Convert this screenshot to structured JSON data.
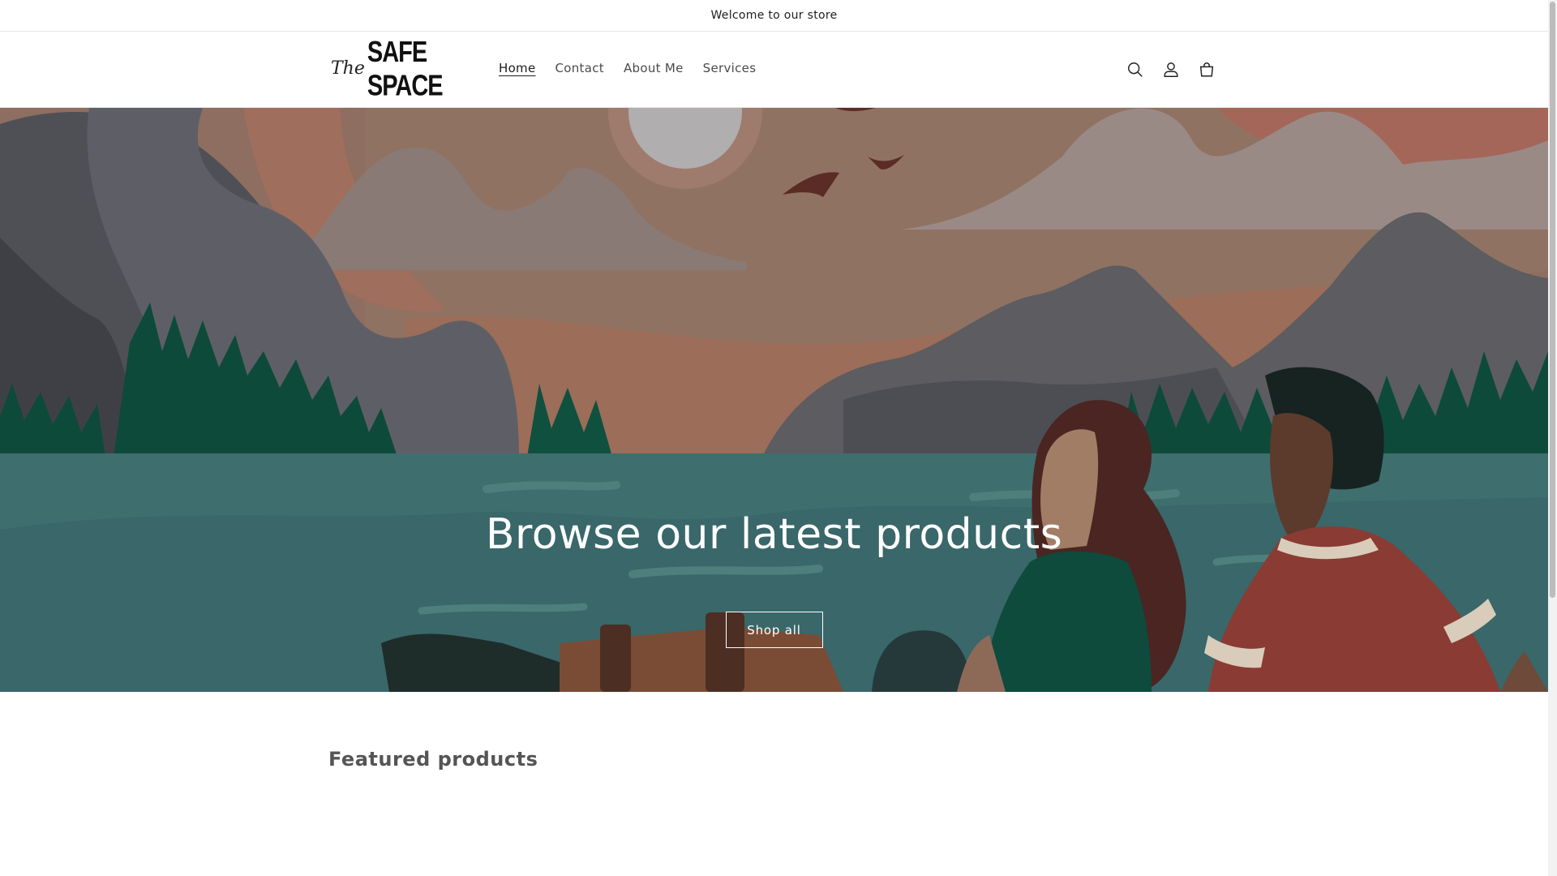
{
  "announcement": {
    "text": "Welcome to our store"
  },
  "header": {
    "logo_prefix": "The",
    "logo_name": "SAFE SPACE",
    "nav": [
      {
        "label": "Home",
        "active": true
      },
      {
        "label": "Contact",
        "active": false
      },
      {
        "label": "About Me",
        "active": false
      },
      {
        "label": "Services",
        "active": false
      }
    ],
    "icons": [
      "search-icon",
      "account-icon",
      "cart-icon"
    ]
  },
  "hero": {
    "title": "Browse our latest products",
    "button_label": "Shop all"
  },
  "featured": {
    "title": "Featured products"
  },
  "colors": {
    "sky": "#8d6e60",
    "water": "#3d6b6b",
    "forest": "#0d4a3a",
    "mountain": "#5c5c61"
  }
}
